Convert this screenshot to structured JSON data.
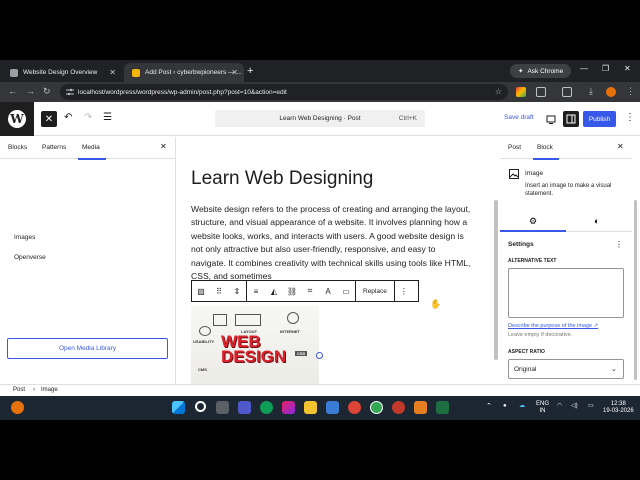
{
  "browser": {
    "tabs": [
      {
        "title": "Website Design Overview",
        "active": false
      },
      {
        "title": "Add Post ‹ cyberbwpioneers — ...",
        "active": true
      }
    ],
    "new_tab": "+",
    "ask_chrome": "Ask Chrome",
    "url": "localhost/wordpress/wordpress/wp-admin/post.php?post=10&action=edit"
  },
  "editor": {
    "command_bar": "Learn Web Designing · Post",
    "command_shortcut": "Ctrl+K",
    "save_draft": "Save draft",
    "publish": "Publish"
  },
  "inserter": {
    "tabs": [
      "Blocks",
      "Patterns",
      "Media"
    ],
    "active_tab": "Media",
    "items": [
      "Images",
      "Openverse"
    ],
    "open_media_library": "Open Media Library"
  },
  "content": {
    "title": "Learn Web Designing",
    "paragraph": "Website design refers to the process of creating and arranging the layout, structure, and visual appearance of a website. It involves planning how a website looks, works, and interacts with users. A good website design is not only attractive but also user-friendly, responsive, and easy to navigate. It combines creativity with technical skills using tools like HTML, CSS, and sometimes",
    "block_toolbar_replace": "Replace",
    "image_text": [
      "WEB",
      "DESIGN"
    ],
    "image_labels": [
      "USABILITY",
      "LAYOUT",
      "INTERNET",
      "CSS",
      "CMS"
    ]
  },
  "sidebar": {
    "tabs": [
      "Post",
      "Block"
    ],
    "active_tab": "Block",
    "block_title": "Image",
    "block_desc": "Insert an image to make a visual statement.",
    "settings_label": "Settings",
    "alt_text_label": "ALTERNATIVE TEXT",
    "alt_text_value": "",
    "describe_link": "Describe the purpose of the image ↗",
    "leave_empty": "Leave empty if decorative.",
    "aspect_label": "ASPECT RATIO",
    "aspect_value": "Original"
  },
  "breadcrumb": [
    "Post",
    "Image"
  ],
  "taskbar": {
    "lang": "ENG",
    "region": "IN",
    "time": "12:38",
    "date": "19-03-2026"
  }
}
